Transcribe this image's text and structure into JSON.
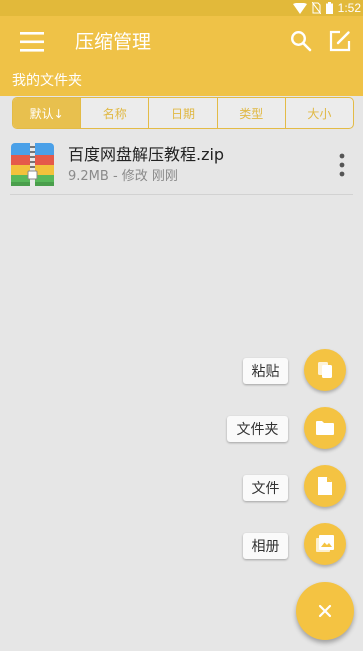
{
  "status_bar": {
    "time": "1:52"
  },
  "app_bar": {
    "title": "压缩管理",
    "menu_icon": "hamburger-menu-icon",
    "search_icon": "search-icon",
    "edit_icon": "edit-icon"
  },
  "path": {
    "label": "我的文件夹"
  },
  "sort_tabs": [
    {
      "label": "默认↓",
      "active": true
    },
    {
      "label": "名称",
      "active": false
    },
    {
      "label": "日期",
      "active": false
    },
    {
      "label": "类型",
      "active": false
    },
    {
      "label": "大小",
      "active": false
    }
  ],
  "files": [
    {
      "name": "百度网盘解压教程.zip",
      "meta": "9.2MB - 修改 刚刚",
      "icon": "zip-archive-icon"
    }
  ],
  "fab_menu": {
    "items": [
      {
        "label": "粘贴",
        "icon": "paste-icon"
      },
      {
        "label": "文件夹",
        "icon": "folder-icon"
      },
      {
        "label": "文件",
        "icon": "file-icon"
      },
      {
        "label": "相册",
        "icon": "photo-album-icon"
      }
    ],
    "close_icon": "close-icon"
  },
  "colors": {
    "primary": "#efc247",
    "status_bar": "#e2b93a",
    "fab": "#f4c342",
    "background": "#e6e6e6"
  }
}
